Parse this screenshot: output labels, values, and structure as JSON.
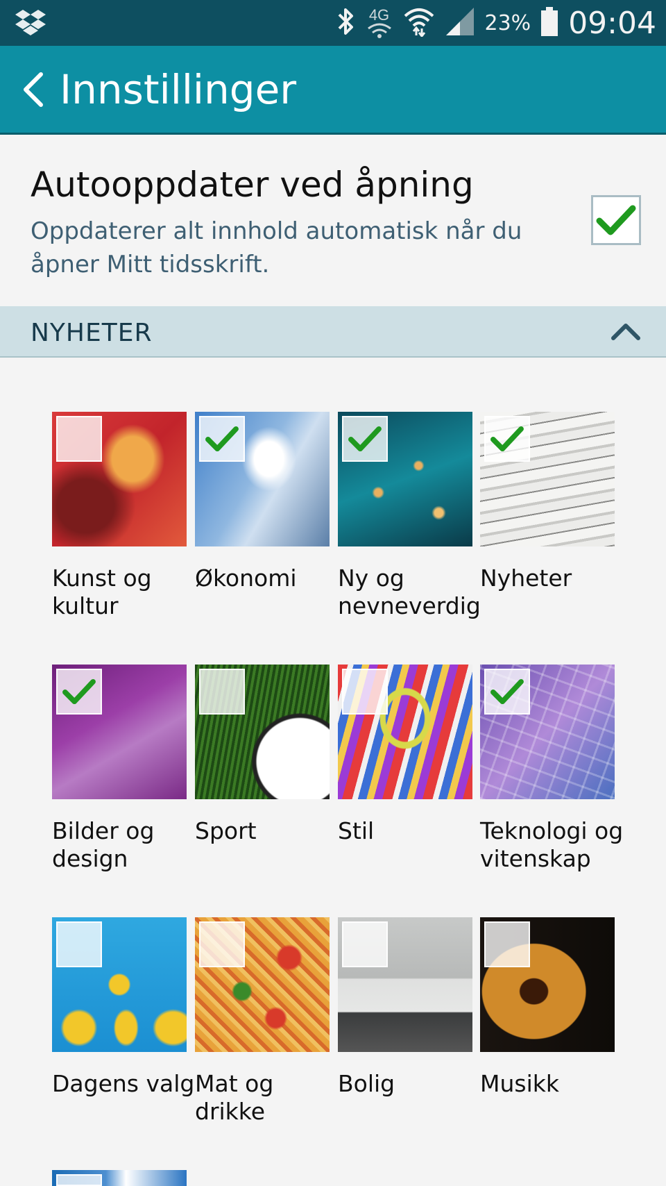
{
  "status_bar": {
    "network": "4G",
    "battery": "23%",
    "time": "09:04"
  },
  "header": {
    "title": "Innstillinger"
  },
  "auto_update": {
    "title": "Autooppdater ved åpning",
    "description": "Oppdaterer alt innhold automatisk når du åpner Mitt tidsskrift.",
    "checked": true
  },
  "section": {
    "label": "NYHETER"
  },
  "categories": [
    {
      "label": "Kunst og kultur",
      "checked": false
    },
    {
      "label": "Økonomi",
      "checked": true
    },
    {
      "label": "Ny og nevneverdig",
      "checked": true
    },
    {
      "label": "Nyheter",
      "checked": true
    },
    {
      "label": "Bilder og design",
      "checked": true
    },
    {
      "label": "Sport",
      "checked": false
    },
    {
      "label": "Stil",
      "checked": false
    },
    {
      "label": "Teknologi og vitenskap",
      "checked": true
    },
    {
      "label": "Dagens valg",
      "checked": false
    },
    {
      "label": "Mat og drikke",
      "checked": false
    },
    {
      "label": "Bolig",
      "checked": false
    },
    {
      "label": "Musikk",
      "checked": false
    }
  ],
  "colors": {
    "status_bar": "#0e4f60",
    "action_bar": "#0d8fa3",
    "section_header": "#cddfe4",
    "check_green": "#1f9a1f"
  }
}
